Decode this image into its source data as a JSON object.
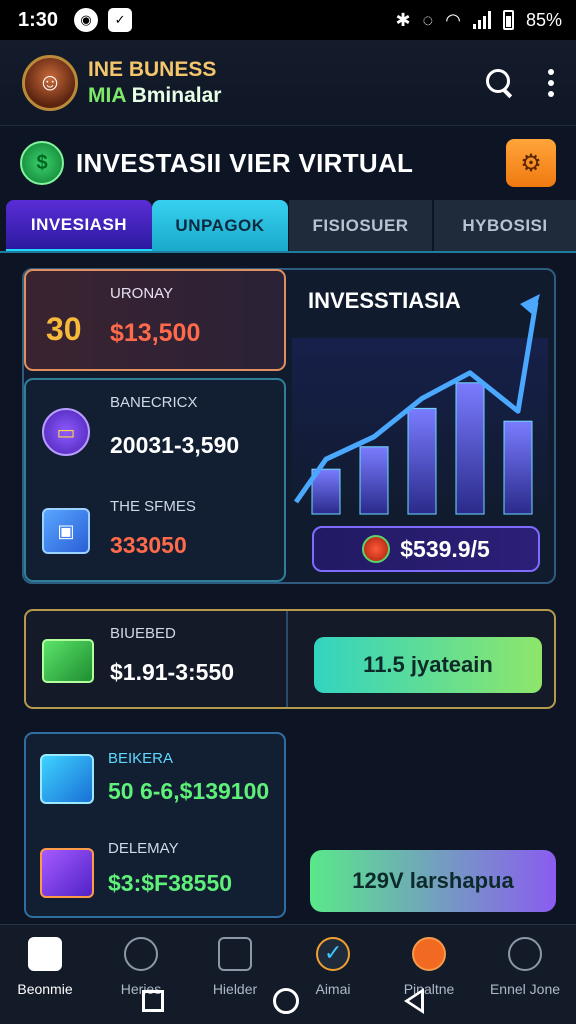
{
  "status_bar": {
    "time": "1:30",
    "battery": "85%"
  },
  "app": {
    "brand_line1": "INE BUNESS",
    "brand_line2_acc": "MIA",
    "brand_line2": "Bminalar"
  },
  "header": {
    "title": "INVESTASII VIER VIRTUAL"
  },
  "tabs": [
    {
      "label": "INVESIASH"
    },
    {
      "label": "UNPAGOK"
    },
    {
      "label": "FISIOSUER"
    },
    {
      "label": "HYBOSISI"
    }
  ],
  "cards": {
    "uronay": {
      "big": "30",
      "label": "URONAY",
      "value": "$13,500"
    },
    "banecricx": {
      "label": "BANECRICX",
      "value": "20031-3,590"
    },
    "the_sfmes": {
      "label": "THE SFMES",
      "value": "333050"
    },
    "biuebed": {
      "label": "BIUEBED",
      "value": "$1.91-3:550"
    },
    "beikera": {
      "label": "BEIKERA",
      "value": "50 6-6,$139100"
    },
    "delemay": {
      "label": "DELEMAY",
      "value": "$3:$F38550"
    }
  },
  "chart": {
    "title": "INVESSTIASIA",
    "value_pill": "$539.9/5"
  },
  "buttons": {
    "primary": "11.5 jyateain",
    "secondary": "129V larshapua"
  },
  "bottom_nav": [
    {
      "label": "Beonmie"
    },
    {
      "label": "Heries"
    },
    {
      "label": "Hielder"
    },
    {
      "label": "Aimai"
    },
    {
      "label": "Pinaltne"
    },
    {
      "label": "Ennel Jone"
    }
  ],
  "colors": {
    "accent_cyan": "#20d7ff",
    "accent_purple": "#5a2dd6",
    "accent_orange": "#f07a10",
    "value_red": "#ff6a4a",
    "value_green": "#5ff07a"
  },
  "chart_data": {
    "type": "bar",
    "categories": [
      "",
      "",
      "",
      "",
      ""
    ],
    "values": [
      28,
      42,
      66,
      82,
      58
    ]
  }
}
